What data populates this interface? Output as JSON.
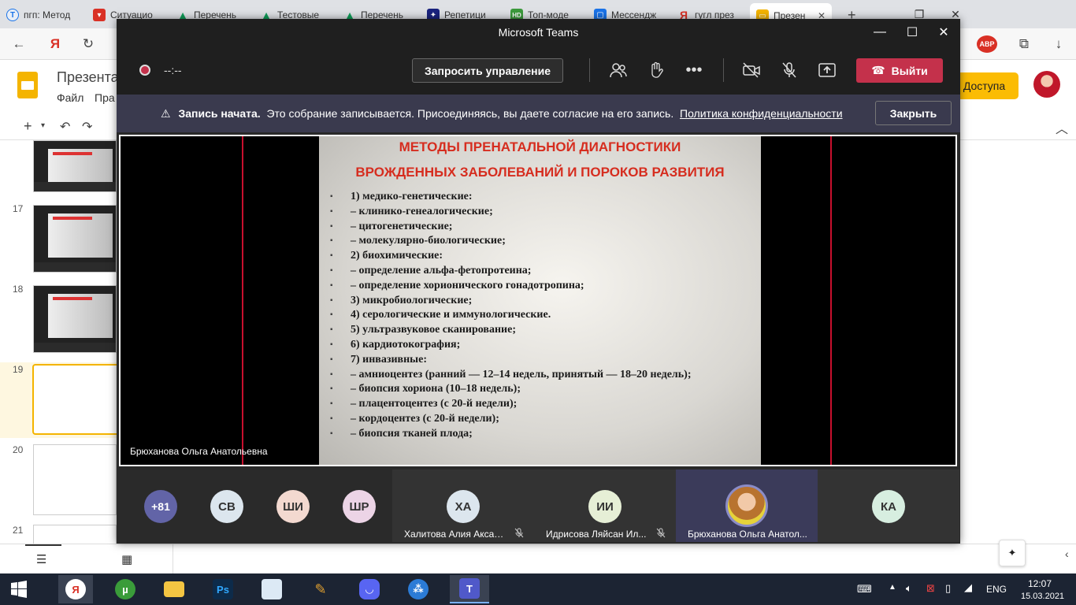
{
  "browser": {
    "tabs": [
      {
        "label": "пгп: Метод",
        "icon": "tutor-icon",
        "color": "#1a73e8"
      },
      {
        "label": "Ситуацио",
        "icon": "pdf-icon",
        "color": "#d93025"
      },
      {
        "label": "Перечень",
        "icon": "drive-icon",
        "color": "#0f9d58"
      },
      {
        "label": "Тестовые",
        "icon": "drive-icon",
        "color": "#0f9d58"
      },
      {
        "label": "Перечень",
        "icon": "drive-icon",
        "color": "#0f9d58"
      },
      {
        "label": "Репетици",
        "icon": "bookmark-icon",
        "color": "#1a237e"
      },
      {
        "label": "Топ-моде",
        "icon": "hd-icon",
        "color": "#3c9a3c"
      },
      {
        "label": "Мессендж",
        "icon": "messenger-icon",
        "color": "#1a73e8"
      },
      {
        "label": "гугл през",
        "icon": "yandex-icon",
        "color": "#d93025"
      },
      {
        "label": "Презен",
        "icon": "slides-icon",
        "color": "#f4b400"
      }
    ],
    "new_tab_label": "+",
    "addressbar_badge": "ABP"
  },
  "slides_app": {
    "title": "Презента",
    "menu": [
      "Файл",
      "Пра"
    ],
    "share_label": "Доступа",
    "slide_numbers": [
      "17",
      "18",
      "19",
      "20",
      "21"
    ]
  },
  "teams": {
    "window_title": "Microsoft Teams",
    "timer": "--:--",
    "request_control": "Запросить управление",
    "leave_label": "Выйти",
    "banner": {
      "bold": "Запись начата.",
      "text": "Это собрание записывается. Присоединяясь, вы даете согласие на его запись.",
      "link": "Политика конфиденциальности",
      "close": "Закрыть"
    },
    "presenter_name": "Брюханова Ольга Анатольевна",
    "slide": {
      "title_line1": "МЕТОДЫ ПРЕНАТАЛЬНОЙ ДИАГНОСТИКИ",
      "title_line2": "ВРОЖДЕННЫХ ЗАБОЛЕВАНИЙ И ПОРОКОВ РАЗВИТИЯ",
      "items": [
        "1) медико-генетические:",
        "– клинико-генеалогические;",
        "– цитогенетические;",
        "– молекулярно-биологические;",
        "2) биохимические:",
        "– определение альфа-фетопротеина;",
        "– определение хорионического гонадотропина;",
        "3) микробиологические;",
        "4) серологические и иммунологические.",
        "5) ультразвуковое сканирование;",
        "6) кардиотокография;",
        "7) инвазивные:",
        "– амниоцентез (ранний — 12–14 недель, принятый — 18–20 недель);",
        "– биопсия хориона (10–18 недель);",
        "– плацентоцентез (с 20-й недели);",
        "– кордоцентез (с 20-й недели);",
        "– биопсия тканей плода;"
      ]
    },
    "participants": {
      "overflow": "+81",
      "avatars": [
        {
          "initials": "СВ",
          "color": "#dce6ee"
        },
        {
          "initials": "ШИ",
          "color": "#f3d9d0"
        },
        {
          "initials": "ШР",
          "color": "#ecd4e6"
        }
      ],
      "tiles": [
        {
          "initials": "ХА",
          "name": "Халитова Алия Аксан...",
          "color": "#dce6ee"
        },
        {
          "initials": "ИИ",
          "name": "Идрисова Ляйсан Ил...",
          "color": "#e6efd6"
        },
        {
          "initials": "",
          "name": "Брюханова Ольга Анатол...",
          "color": "#d8a077"
        },
        {
          "initials": "КА",
          "name": "",
          "color": "#d7eee0"
        }
      ]
    }
  },
  "taskbar": {
    "apps": [
      {
        "icon": "windows-start-icon"
      },
      {
        "icon": "yandex-browser-icon",
        "color": "#e0e0e0",
        "glyph": "Я"
      },
      {
        "icon": "utorrent-icon",
        "color": "#3a9c3a",
        "glyph": "µ"
      },
      {
        "icon": "file-explorer-icon",
        "color": "#f4c542",
        "glyph": ""
      },
      {
        "icon": "photoshop-icon",
        "color": "#0d2b4a",
        "glyph": "Ps"
      },
      {
        "icon": "maps-icon",
        "color": "#dce9f5",
        "glyph": ""
      },
      {
        "icon": "pencil-icon",
        "color": "#1c2433",
        "glyph": ""
      },
      {
        "icon": "discord-icon",
        "color": "#5865f2",
        "glyph": ""
      },
      {
        "icon": "network-app-icon",
        "color": "#2b7bd6",
        "glyph": ""
      },
      {
        "icon": "teams-icon",
        "color": "#5059c9",
        "glyph": "T"
      }
    ],
    "lang": "ENG",
    "time": "12:07",
    "date": "15.03.2021"
  }
}
